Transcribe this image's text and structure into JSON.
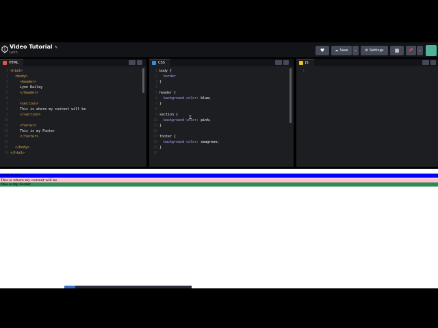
{
  "header": {
    "title": "Video Tutorial",
    "owner": "Lynn",
    "buttons": {
      "save": "Save",
      "settings": "Settings"
    }
  },
  "editors": {
    "html": {
      "label": "HTML",
      "badge_color": "#e2553f",
      "lines": [
        {
          "n": "1",
          "text": "<html>",
          "k": "tag",
          "indent": 0
        },
        {
          "n": "2",
          "text": "<body>",
          "k": "tag",
          "indent": 1
        },
        {
          "n": "3",
          "text": "<header>",
          "k": "tag",
          "indent": 2
        },
        {
          "n": "4",
          "text": "Lynn Bailey",
          "k": "txt",
          "indent": 2
        },
        {
          "n": "5",
          "text": "</header>",
          "k": "tag",
          "indent": 2
        },
        {
          "n": "6",
          "text": "",
          "k": "txt",
          "indent": 0
        },
        {
          "n": "7",
          "text": "<section>",
          "k": "tag",
          "indent": 2
        },
        {
          "n": "8",
          "text": "This is where my content will be",
          "k": "txt",
          "indent": 2
        },
        {
          "n": "9",
          "text": "</section>",
          "k": "tag",
          "indent": 2
        },
        {
          "n": "10",
          "text": "",
          "k": "txt",
          "indent": 0
        },
        {
          "n": "11",
          "text": "<footer>",
          "k": "tag",
          "indent": 2
        },
        {
          "n": "12",
          "text": "This is my Footer",
          "k": "txt",
          "indent": 2
        },
        {
          "n": "13",
          "text": "</footer>",
          "k": "tag",
          "indent": 2
        },
        {
          "n": "14",
          "text": "",
          "k": "txt",
          "indent": 0
        },
        {
          "n": "15",
          "text": "</body>",
          "k": "tag",
          "indent": 1
        },
        {
          "n": "16",
          "text": "</html>",
          "k": "tag",
          "indent": 0
        }
      ]
    },
    "css": {
      "label": "CSS",
      "badge_color": "#3a8fd6",
      "lines": [
        {
          "n": "1",
          "parts": [
            [
              "sel",
              "body {"
            ]
          ]
        },
        {
          "n": "2",
          "parts": [
            [
              "prop",
              "  border"
            ]
          ]
        },
        {
          "n": "3",
          "parts": [
            [
              "sel",
              "}"
            ]
          ]
        },
        {
          "n": "4",
          "parts": []
        },
        {
          "n": "5",
          "parts": [
            [
              "sel",
              "header {"
            ]
          ]
        },
        {
          "n": "6",
          "parts": [
            [
              "prop",
              "  background-color: "
            ],
            [
              "val",
              "blue;"
            ]
          ]
        },
        {
          "n": "7",
          "parts": [
            [
              "sel",
              "}"
            ]
          ]
        },
        {
          "n": "8",
          "parts": []
        },
        {
          "n": "9",
          "parts": [
            [
              "sel",
              "section {"
            ]
          ]
        },
        {
          "n": "10",
          "parts": [
            [
              "prop",
              "  background-color: "
            ],
            [
              "val",
              "pink;"
            ]
          ]
        },
        {
          "n": "11",
          "parts": [
            [
              "sel",
              "}"
            ]
          ]
        },
        {
          "n": "12",
          "parts": []
        },
        {
          "n": "13",
          "parts": [
            [
              "sel",
              "footer {"
            ]
          ]
        },
        {
          "n": "14",
          "parts": [
            [
              "prop",
              "  background-color: "
            ],
            [
              "val",
              "seagreen;"
            ]
          ]
        },
        {
          "n": "15",
          "parts": [
            [
              "sel",
              "}"
            ]
          ]
        },
        {
          "n": "16",
          "parts": []
        }
      ]
    },
    "js": {
      "label": "JS",
      "badge_color": "#f0c21b",
      "lines": [
        {
          "n": "1",
          "parts": []
        }
      ]
    }
  },
  "preview": {
    "rows": [
      {
        "text": "Lynn Bailey",
        "color": "#0000ff"
      },
      {
        "text": "This is where my content will be",
        "color": "#ffc0cb"
      },
      {
        "text": "This is my Footer",
        "color": "#2e8b57"
      }
    ]
  }
}
